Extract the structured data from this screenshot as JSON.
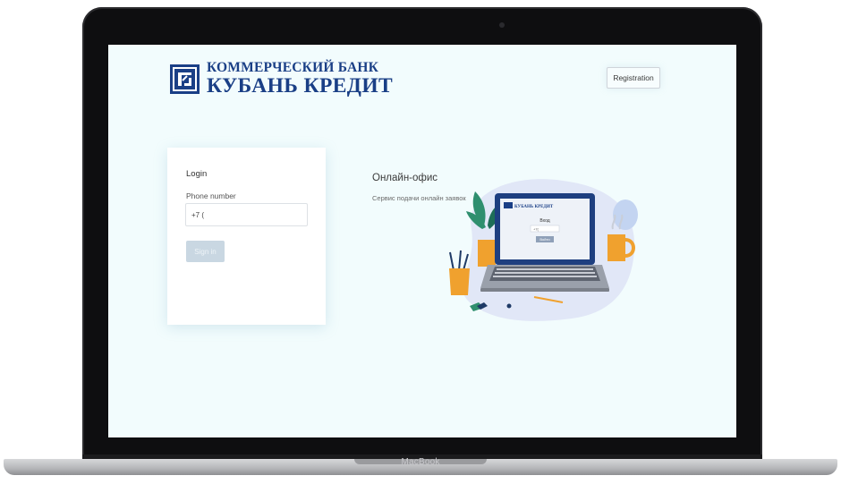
{
  "device": {
    "label": "MacBook"
  },
  "header": {
    "logo_line1": "КОММЕРЧЕСКИЙ БАНК",
    "logo_line2": "КУБАНЬ КРЕДИТ",
    "registration_label": "Registration"
  },
  "login": {
    "title": "Login",
    "phone_label": "Phone number",
    "phone_value": "+7 (",
    "signin_label": "Sign in"
  },
  "office": {
    "title": "Онлайн-офис",
    "subtitle": "Сервис подачи онлайн заявок"
  },
  "illustration": {
    "mini_logo": "КУБАНЬ КРЕДИТ",
    "mini_title": "Вход",
    "mini_input": "+7(",
    "mini_button": "Войти"
  },
  "colors": {
    "brand": "#1a3f86",
    "screen_bg": "#f2fcfd",
    "button_disabled": "#c9d7e2"
  }
}
